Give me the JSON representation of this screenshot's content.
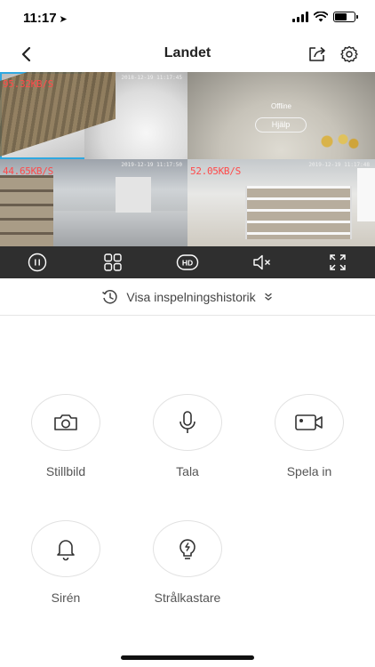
{
  "status_bar": {
    "time": "11:17",
    "location_arrow": "location-arrow-icon"
  },
  "nav": {
    "title": "Landet",
    "icons": [
      "back-chevron-icon",
      "share-icon",
      "gear-icon"
    ]
  },
  "cameras": [
    {
      "speed": "95.32KB/S",
      "timestamp": "2018-12-19 11:17:45",
      "selected": true
    },
    {
      "status": "Offline",
      "help_label": "Hjälp"
    },
    {
      "speed": "44.65KB/S",
      "timestamp": "2019-12-19 11:17:50"
    },
    {
      "speed": "52.05KB/S",
      "timestamp": "2019-12-19 11:17:48"
    }
  ],
  "toolbar": {
    "items": [
      "pause-icon",
      "grid-layout-icon",
      "hd-icon",
      "mute-icon",
      "fullscreen-icon"
    ],
    "hd_label": "HD"
  },
  "history": {
    "label": "Visa inspelningshistorik"
  },
  "actions": {
    "snapshot": "Stillbild",
    "talk": "Tala",
    "record": "Spela in",
    "siren": "Sirén",
    "floodlight": "Strålkastare"
  },
  "colors": {
    "accent_selected": "#2fa8e0",
    "speed_text": "#ff4a4a",
    "toolbar_bg": "#2f2f2f"
  }
}
